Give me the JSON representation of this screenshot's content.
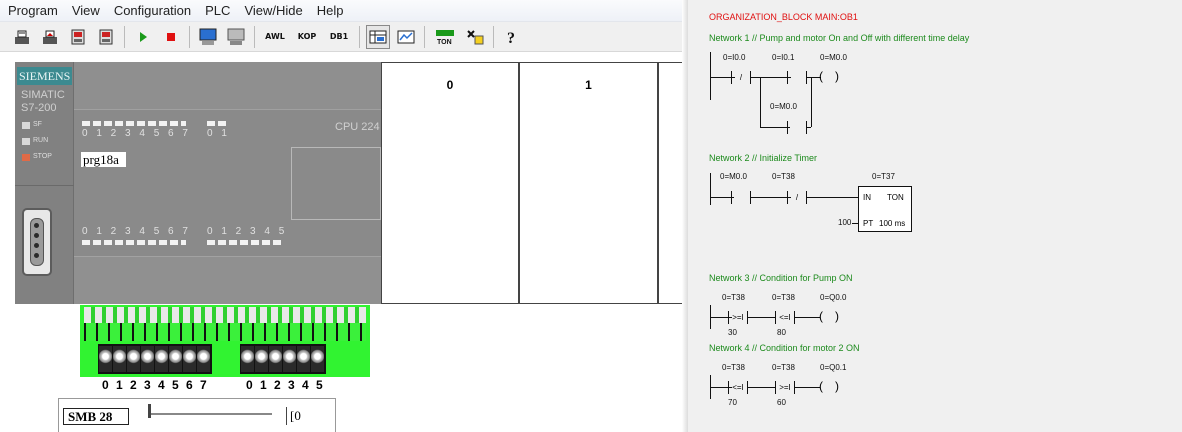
{
  "menu": [
    "Program",
    "View",
    "Configuration",
    "PLC",
    "View/Hide",
    "Help"
  ],
  "toolbar": {
    "awl": "AWL",
    "kop": "KOP",
    "db1": "DB1",
    "ton": "TON"
  },
  "plc": {
    "brand": "SIEMENS",
    "model_line1": "SIMATIC",
    "model_line2": "S7-200",
    "leds": [
      "SF",
      "RUN",
      "STOP"
    ],
    "cpu": "CPU 224",
    "program": "prg18a",
    "inputs_a": "0 1 2 3 4 5 6 7",
    "inputs_b": "0 1",
    "outputs_a": "0 1 2 3 4 5 6 7",
    "outputs_b": "0 1 2 3 4 5"
  },
  "modules": [
    "0",
    "1"
  ],
  "switches": {
    "group_a": "0 1 2 3 4 5 6 7",
    "group_b": "0 1 2 3 4 5"
  },
  "smb": {
    "label": "SMB 28",
    "value": "0",
    "level": 0
  },
  "ladder": {
    "block_title": "ORGANIZATION_BLOCK MAIN:OB1",
    "networks": [
      {
        "title": "Network 1 // Pump and motor On and Off with different time delay",
        "op1": "0=I0.0",
        "op1_sym": "/",
        "op2": "0=I0.1",
        "coil": "0=M0.0",
        "branch": "0=M0.0"
      },
      {
        "title": "Network 2 // Initialize Timer",
        "op1": "0=M0.0",
        "op2": "0=T38",
        "op2_sym": "/",
        "timer_name": "0=T37",
        "timer_in": "IN",
        "timer_type": "TON",
        "timer_pt_val": "100",
        "timer_pt": "PT",
        "timer_base": "100 ms"
      },
      {
        "title": "Network 3 // Condition for Pump ON",
        "op1": "0=T38",
        "cmp1": ">=I",
        "val1": "30",
        "op2": "0=T38",
        "cmp2": "<=I",
        "val2": "80",
        "coil": "0=Q0.0"
      },
      {
        "title": "Network 4 // Condition for motor 2 ON",
        "op1": "0=T38",
        "cmp1": "<=I",
        "val1": "70",
        "op2": "0=T38",
        "cmp2": ">=I",
        "val2": "60",
        "coil": "0=Q0.1"
      }
    ]
  },
  "colors": {
    "brand_teal": "#3c8a90",
    "terminal_green": "#31f331",
    "block_title_red": "#e01010",
    "network_green": "#1c8a1c"
  }
}
